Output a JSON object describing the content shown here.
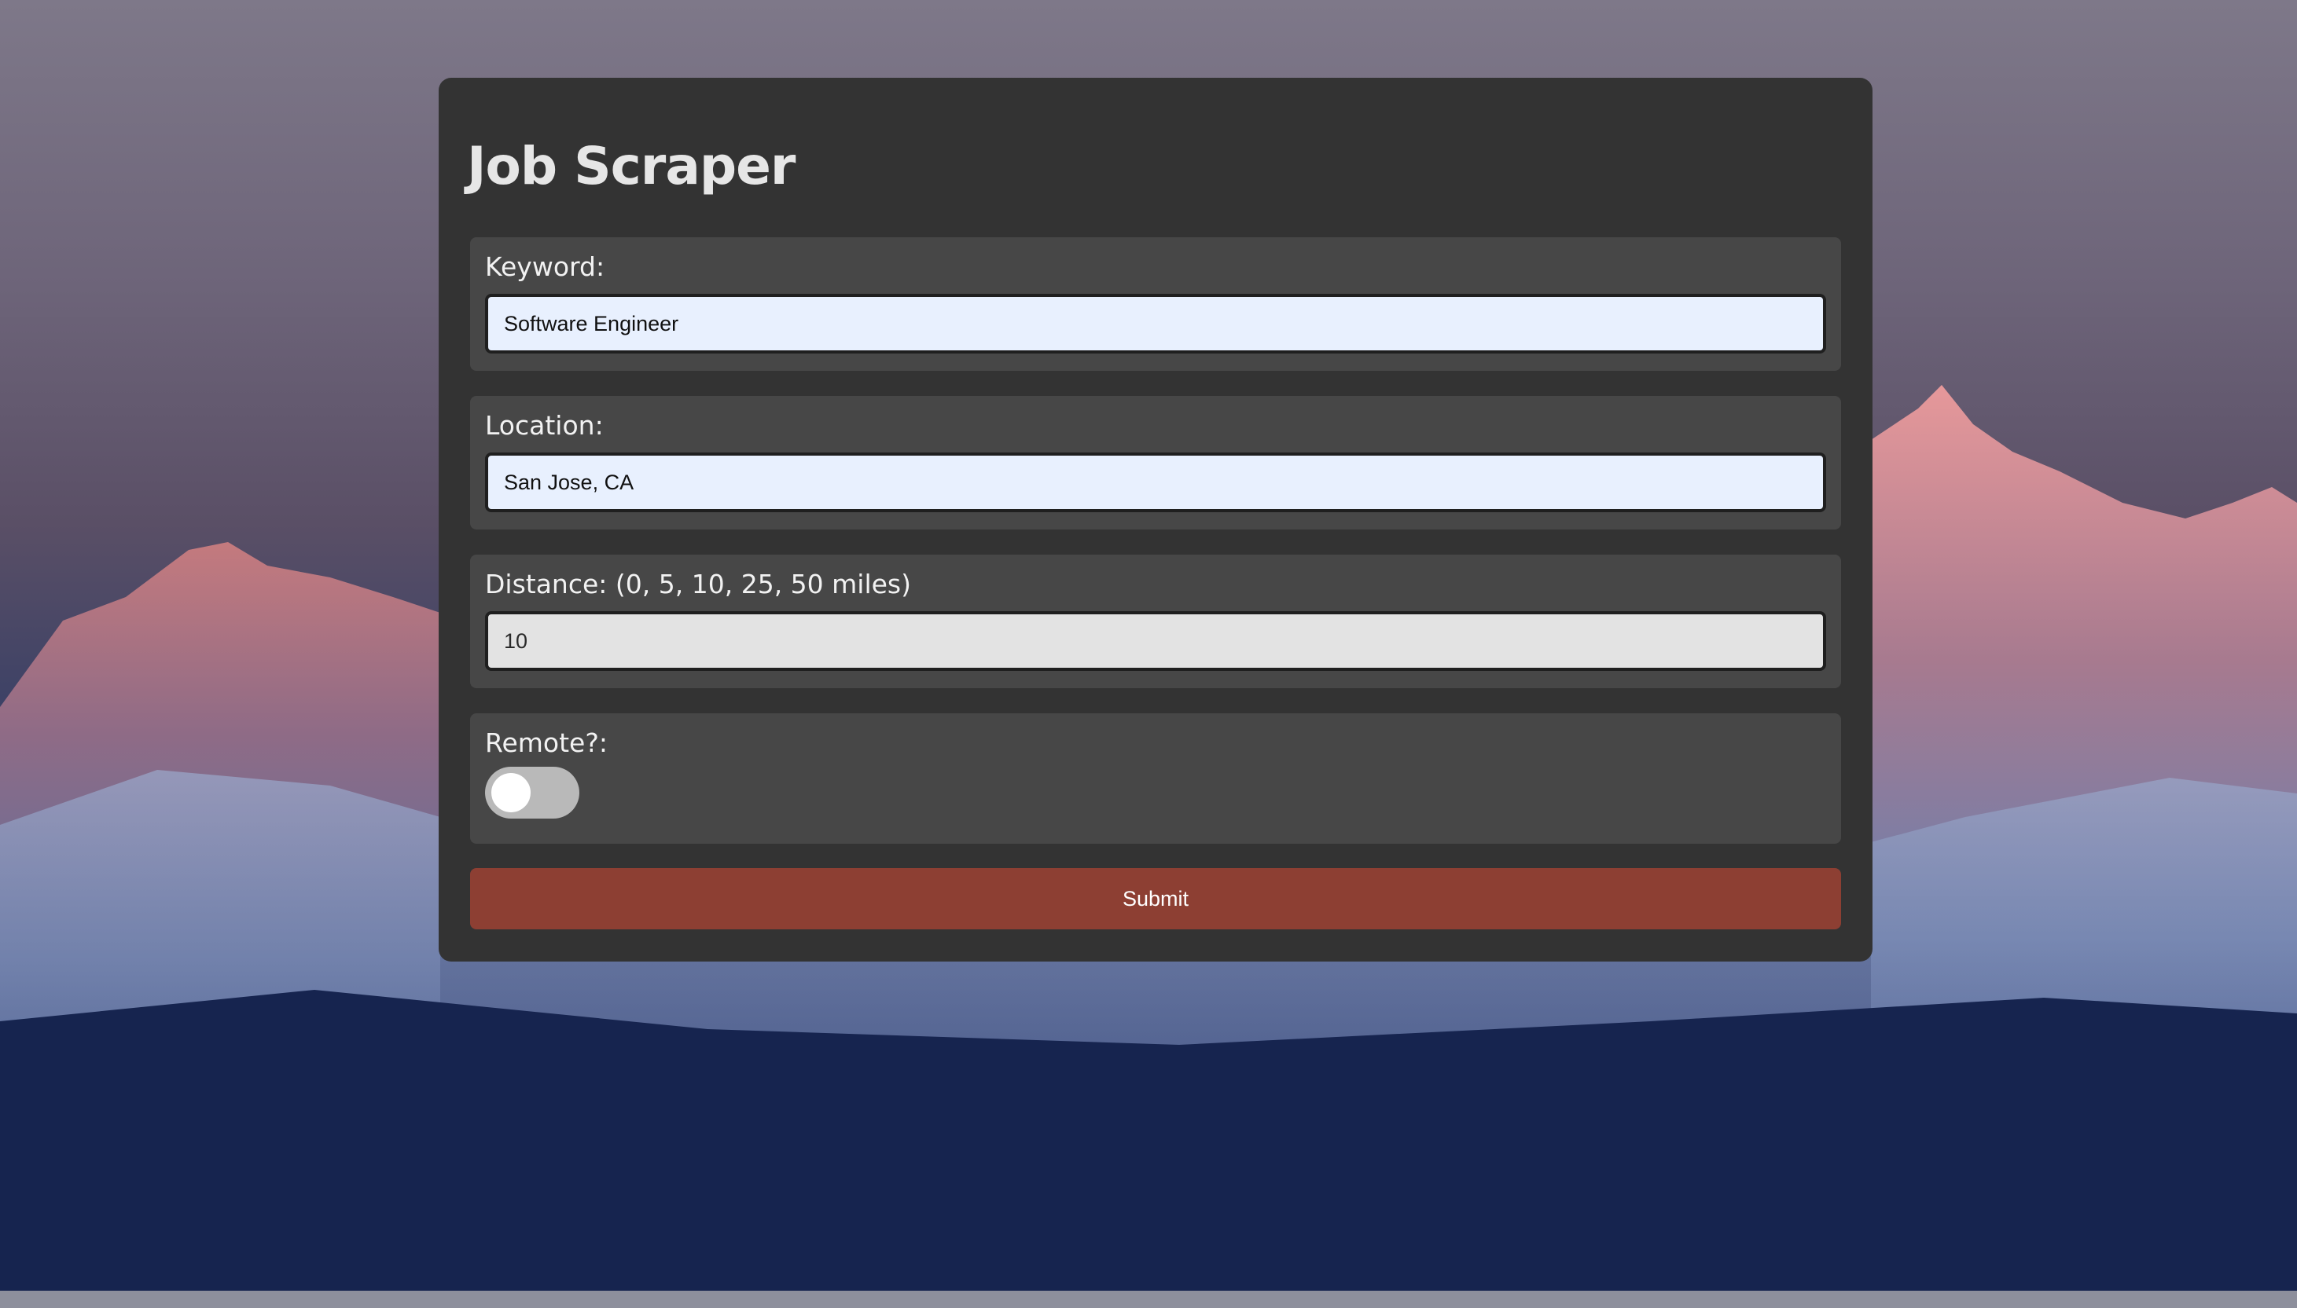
{
  "app": {
    "title": "Job Scraper"
  },
  "form": {
    "keyword": {
      "label": "Keyword:",
      "value": "Software Engineer"
    },
    "location": {
      "label": "Location:",
      "value": "San Jose, CA"
    },
    "distance": {
      "label": "Distance: (0, 5, 10, 25, 50 miles)",
      "value": "10"
    },
    "remote": {
      "label": "Remote?:",
      "checked": false
    },
    "submit_label": "Submit"
  },
  "colors": {
    "card_background": "#333333",
    "group_background": "#474747",
    "submit_button": "#8d3f33",
    "autofill_input": "#e8f0fe",
    "toggle_off": "#b9b9b9"
  }
}
